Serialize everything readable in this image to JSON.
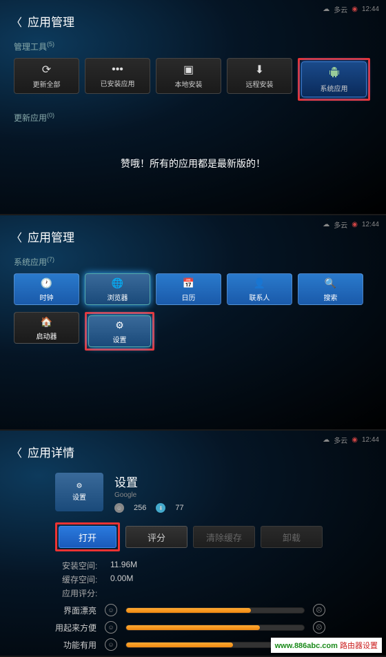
{
  "status": {
    "weather_icon": "☁",
    "weather": "多云",
    "time": "12:44"
  },
  "screen1": {
    "title": "应用管理",
    "section_tools": "管理工具",
    "tools_count": "5",
    "tools": [
      {
        "icon": "⟳",
        "label": "更新全部"
      },
      {
        "icon": "•••",
        "label": "已安装应用"
      },
      {
        "icon": "▣",
        "label": "本地安装"
      },
      {
        "icon": "⬇",
        "label": "远程安装"
      },
      {
        "icon": "◉",
        "label": "系统应用"
      }
    ],
    "section_updates": "更新应用",
    "updates_count": "0",
    "empty_message": "赞哦！所有的应用都是最新版的！"
  },
  "screen2": {
    "title": "应用管理",
    "section_apps": "系统应用",
    "apps_count": "7",
    "apps": [
      {
        "label": "时钟"
      },
      {
        "label": "浏览器"
      },
      {
        "label": "日历"
      },
      {
        "label": "联系人"
      },
      {
        "label": "搜索"
      },
      {
        "label": "启动器"
      },
      {
        "label": "设置"
      }
    ]
  },
  "screen3": {
    "title": "应用详情",
    "app_name": "设置",
    "app_vendor": "Google",
    "icon_label": "设置",
    "stat1": "256",
    "stat2": "77",
    "buttons": {
      "open": "打开",
      "rate": "评分",
      "clear": "清除缓存",
      "uninstall": "卸载"
    },
    "info": {
      "install_label": "安装空间:",
      "install_val": "11.96M",
      "cache_label": "缓存空间:",
      "cache_val": "0.00M",
      "rating_label": "应用评分:"
    },
    "ratings": [
      {
        "label": "界面漂亮",
        "pct": 70
      },
      {
        "label": "用起来方便",
        "pct": 75
      },
      {
        "label": "功能有用",
        "pct": 60
      }
    ]
  },
  "watermark": {
    "url": "www.886abc.com",
    "text": "路由器设置"
  }
}
